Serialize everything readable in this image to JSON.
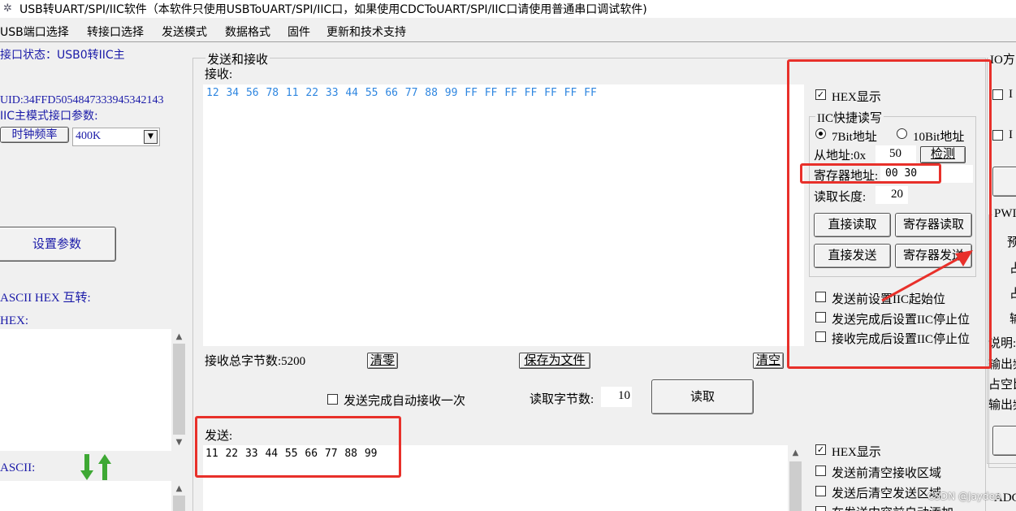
{
  "window": {
    "title": "USB转UART/SPI/IIC软件（本软件只使用USBToUART/SPI/IIC口，如果使用CDCToUART/SPI/IIC口请使用普通串口调试软件)"
  },
  "menu": [
    "USB端口选择",
    "转接口选择",
    "发送模式",
    "数据格式",
    "固件",
    "更新和技术支持"
  ],
  "left_panel": {
    "port_status": "接口状态：USB0转IIC主",
    "uid": "UID:34FFD5054847333945342143",
    "iic_params_label": "IIC主模式接口参数:",
    "clock_label": "时钟频率",
    "clock_value": "400K",
    "set_params_button": "设置参数",
    "ascii_hex_label": "ASCII HEX 互转:",
    "hex_label": "HEX:",
    "ascii_label": "ASCII:"
  },
  "send_receive": {
    "group_title": "发送和接收",
    "receive_label": "接收:",
    "receive_text": "12 34 56 78 11 22 33 44 55 66 77 88 99 FF FF FF FF FF FF FF",
    "total_bytes_label": "接收总字节数:5200",
    "clear_button": "清零",
    "save_button": "保存为文件",
    "clear_empty_button": "清空",
    "auto_receive_label": "发送完成自动接收一次",
    "read_bytes_label": "读取字节数:",
    "read_bytes_value": "10",
    "read_button": "读取",
    "send_label": "发送:",
    "send_text": "11 22 33 44 55 66 77 88 99"
  },
  "right_options": {
    "hex_display": "HEX显示",
    "iic_quick_title": "IIC快捷读写",
    "radio_7bit": "7Bit地址",
    "radio_10bit": "10Bit地址",
    "slave_addr_label": "从地址:0x",
    "slave_addr_value": "50",
    "detect_button": "检测",
    "reg_addr_label": "寄存器地址:",
    "reg_addr_value": "00 30",
    "read_len_label": "读取长度:",
    "read_len_value": "20",
    "direct_read_button": "直接读取",
    "reg_read_button": "寄存器读取",
    "direct_send_button": "直接发送",
    "reg_send_button": "寄存器发送",
    "chk_start_before": "发送前设置IIC起始位",
    "chk_stop_after_send": "发送完成后设置IIC停止位",
    "chk_stop_after_recv": "接收完成后设置IIC停止位",
    "bottom_hex_display": "HEX显示",
    "chk_clear_recv_before_send": "发送前清空接收区域",
    "chk_clear_send_after_send": "发送后清空发送区域",
    "chk_partial": "在发送内容前自动添加:"
  },
  "far_right": {
    "io_group": "IO方",
    "io_item_1": "I",
    "io_item_2": "I",
    "pwm_group": "PWI",
    "pwm_1": "预",
    "pwm_2": "占",
    "pwm_3": "占",
    "pwm_4": "输",
    "note_1": "说明:",
    "note_2": "输出频",
    "note_3": "占空比",
    "note_4": "输出频",
    "adc_group": "ADC"
  },
  "watermark": "CSDN @Jayden"
}
